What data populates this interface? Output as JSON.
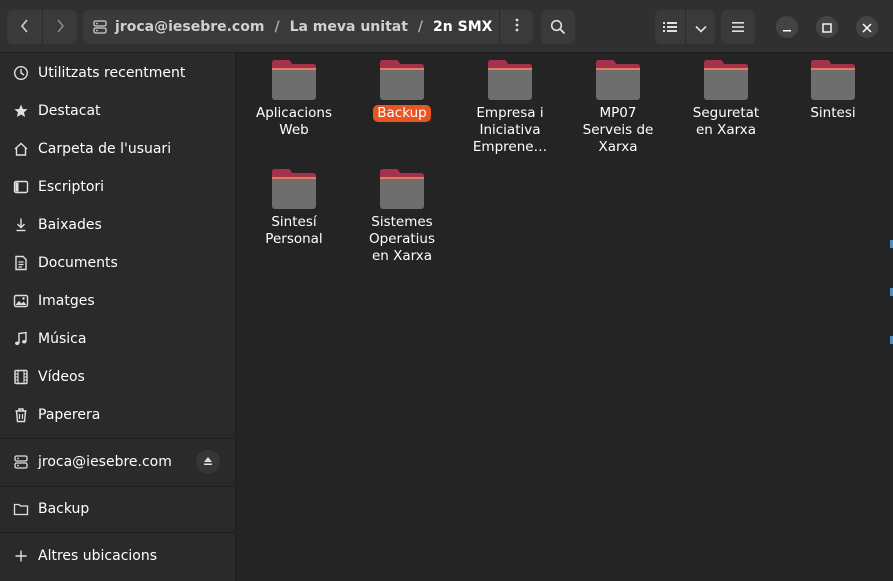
{
  "window": {
    "pathbar": {
      "crumbs": [
        {
          "label": "jroca@iesebre.com"
        },
        {
          "label": "La meva unitat"
        },
        {
          "label": "2n SMX"
        }
      ],
      "separator": "/"
    },
    "icons": {
      "back": "chevron-left-icon",
      "forward": "chevron-right-icon",
      "disk": "network-drive-icon",
      "path_menu": "vertical-dots-icon",
      "search": "search-icon",
      "view_list": "list-view-icon",
      "view_options": "chevron-down-icon",
      "main_menu": "hamburger-icon",
      "minimize": "minimize-icon",
      "maximize": "maximize-icon",
      "close": "close-icon"
    }
  },
  "sidebar": {
    "items": [
      {
        "label": "Utilitzats recentment",
        "icon": "clock-icon"
      },
      {
        "label": "Destacat",
        "icon": "star-icon"
      },
      {
        "label": "Carpeta de l'usuari",
        "icon": "home-icon"
      },
      {
        "label": "Escriptori",
        "icon": "desktop-icon"
      },
      {
        "label": "Baixades",
        "icon": "download-icon"
      },
      {
        "label": "Documents",
        "icon": "document-icon"
      },
      {
        "label": "Imatges",
        "icon": "image-icon"
      },
      {
        "label": "Música",
        "icon": "music-icon"
      },
      {
        "label": "Vídeos",
        "icon": "video-icon"
      },
      {
        "label": "Paperera",
        "icon": "trash-icon"
      }
    ],
    "mount": {
      "label": "jroca@iesebre.com",
      "icon": "network-drive-icon",
      "eject_icon": "eject-icon"
    },
    "bookmark": {
      "label": "Backup",
      "icon": "folder-icon"
    },
    "other": {
      "label": "Altres ubicacions",
      "icon": "plus-icon"
    }
  },
  "files": [
    {
      "name": "Aplicacions Web",
      "lines": [
        "Aplicacions",
        "Web"
      ],
      "selected": false
    },
    {
      "name": "Backup",
      "lines": [
        "Backup"
      ],
      "selected": true
    },
    {
      "name": "Empresa i Iniciativa Emprene…",
      "lines": [
        "Empresa i",
        "Iniciativa",
        "Emprene…"
      ],
      "selected": false
    },
    {
      "name": "MP07 Serveis de Xarxa",
      "lines": [
        "MP07",
        "Serveis de",
        "Xarxa"
      ],
      "selected": false
    },
    {
      "name": "Seguretat en Xarxa",
      "lines": [
        "Seguretat",
        "en Xarxa"
      ],
      "selected": false
    },
    {
      "name": "Sintesi",
      "lines": [
        "Sintesi"
      ],
      "selected": false
    },
    {
      "name": "Sintesí Personal",
      "lines": [
        "Sintesí",
        "Personal"
      ],
      "selected": false
    },
    {
      "name": "Sistemes Operatius en Xarxa",
      "lines": [
        "Sistemes",
        "Operatius",
        "en Xarxa"
      ],
      "selected": false
    }
  ],
  "colors": {
    "accent": "#e95420",
    "folder_tab": "#a6314f",
    "folder_body": "#6e6e6e",
    "sidebar_bg": "#2a2a2a",
    "main_bg": "#242424"
  }
}
